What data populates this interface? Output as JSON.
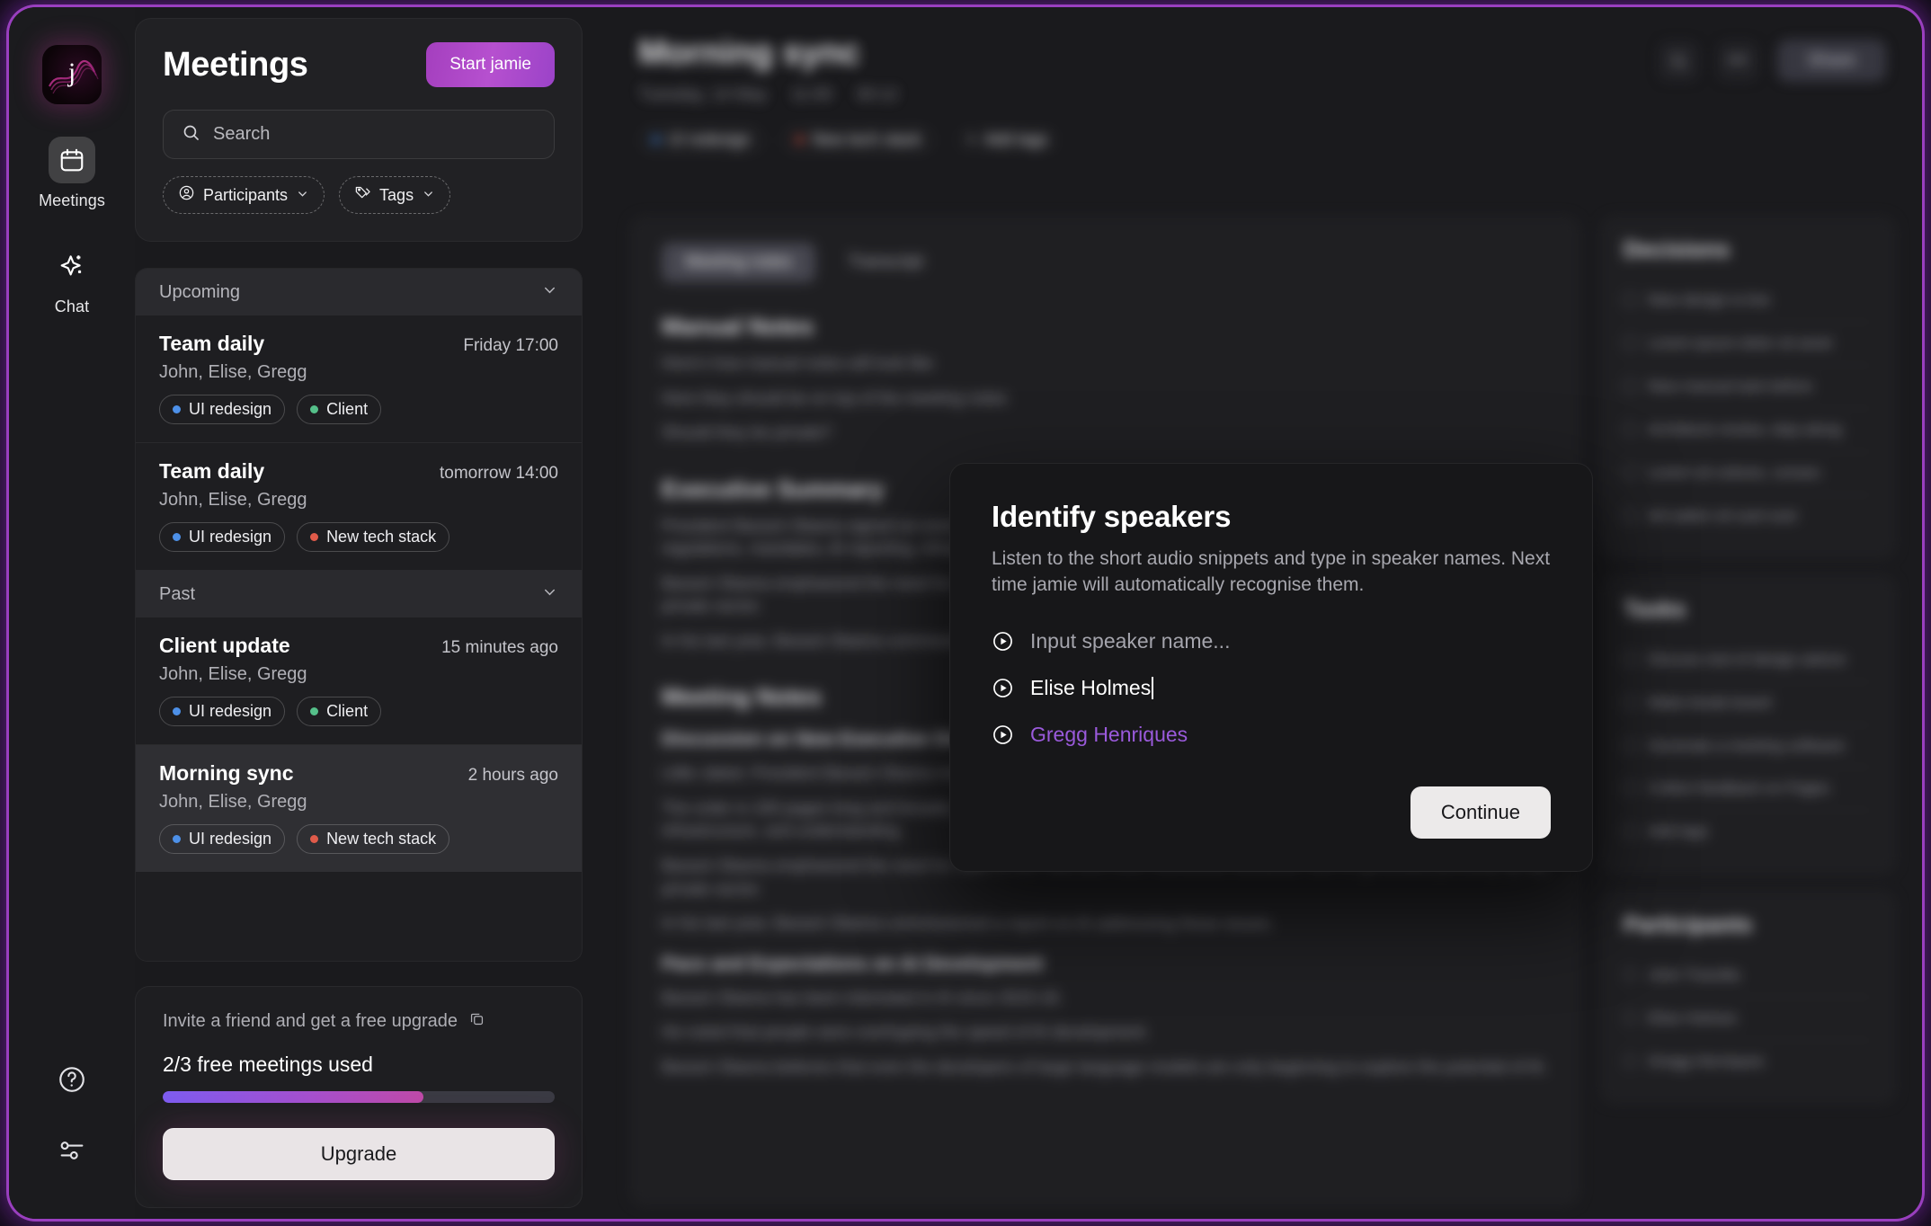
{
  "brand": {
    "logo_letter": "j"
  },
  "rail": {
    "items": [
      {
        "label": "Meetings",
        "icon": "calendar-icon",
        "active": true
      },
      {
        "label": "Chat",
        "icon": "sparkle-icon",
        "active": false
      }
    ],
    "bottom": [
      {
        "icon": "help-circle-icon"
      },
      {
        "icon": "settings-sliders-icon"
      }
    ]
  },
  "sidebar": {
    "title": "Meetings",
    "start_button": "Start jamie",
    "search": {
      "placeholder": "Search",
      "value": ""
    },
    "filters": [
      {
        "label": "Participants",
        "icon": "user-circle-icon"
      },
      {
        "label": "Tags",
        "icon": "tags-icon"
      }
    ],
    "groups": [
      {
        "label": "Upcoming",
        "meetings": [
          {
            "title": "Team daily",
            "time": "Friday 17:00",
            "people": "John, Elise, Gregg",
            "selected": false,
            "tags": [
              {
                "label": "UI redesign",
                "color": "#4d90e8"
              },
              {
                "label": "Client",
                "color": "#55c08a"
              }
            ]
          },
          {
            "title": "Team daily",
            "time": "tomorrow 14:00",
            "people": "John, Elise, Gregg",
            "selected": false,
            "tags": [
              {
                "label": "UI redesign",
                "color": "#4d90e8"
              },
              {
                "label": "New tech stack",
                "color": "#e05b4a"
              }
            ]
          }
        ]
      },
      {
        "label": "Past",
        "meetings": [
          {
            "title": "Client update",
            "time": "15 minutes ago",
            "people": "John, Elise, Gregg",
            "selected": false,
            "tags": [
              {
                "label": "UI redesign",
                "color": "#4d90e8"
              },
              {
                "label": "Client",
                "color": "#55c08a"
              }
            ]
          },
          {
            "title": "Morning sync",
            "time": "2 hours ago",
            "people": "John, Elise, Gregg",
            "selected": true,
            "tags": [
              {
                "label": "UI redesign",
                "color": "#4d90e8"
              },
              {
                "label": "New tech stack",
                "color": "#e05b4a"
              }
            ]
          }
        ]
      }
    ],
    "upgrade": {
      "invite_text": "Invite a friend and get a free upgrade",
      "copy_icon": "copy-icon",
      "usage_text": "2/3 free meetings used",
      "progress_percent": 67,
      "button": "Upgrade",
      "gradient_from": "#7d5cf0",
      "gradient_to": "#bf4aa8"
    }
  },
  "main": {
    "title": "Morning sync",
    "meta": [
      "Tuesday, 14 May",
      "11:00",
      "30:12"
    ],
    "tags": [
      {
        "label": "UI redesign",
        "color": "#4d90e8"
      },
      {
        "label": "New tech stack",
        "color": "#e05b4a"
      },
      {
        "label": "Add tags",
        "color": "#6b6b74"
      }
    ],
    "actions": {
      "search_icon": "search-icon",
      "more_icon": "more-horizontal-icon",
      "share_label": "Share"
    },
    "notes": {
      "tabs": [
        {
          "label": "Meeting notes",
          "active": true
        },
        {
          "label": "Transcript",
          "active": false
        }
      ],
      "sections": [
        {
          "heading": "Manual Notes",
          "bullets": [
            "Here's how manual notes will look like",
            "Here they should be on top of the meeting notes",
            "Should they be private?"
          ]
        },
        {
          "heading": "Executive Summary",
          "bullets": [
            "President Barack Obama signed an executive order on AI development, covering comprehensive regulation, safety regulations, mandates, AI reporting, infrastructure, and understanding.",
            "Barack Obama emphasized the need for rules of the road and more intentional interaction with AI generated primarily by the private sector.",
            "In his last year, Barack Obama commissioned a report on AI addressing these issues."
          ]
        },
        {
          "heading": "Meeting Notes",
          "subsections": [
            {
              "title": "Discussion on New Executive Order about AI",
              "bullets": [
                "Little Jaleel, President Barack Obama mentioned new executive order signed by President Biden.",
                "The order is 100 pages long and broadly covers comprehensive regulation, safety regulations, mandates, AI reporting, infrastructure, and understanding.",
                "Barack Obama emphasized the need for rules of the road and more intentional interaction with AI generated primarily by the private sector.",
                "In his last year, Barack Obama commissioned a report on AI addressing these issues."
              ]
            },
            {
              "title": "Pace and Expectations on AI Development",
              "bullets": [
                "Barack Obama has been interested in AI since 2015-16.",
                "He noted that people were overhyping the speed of AI development.",
                "Barack Obama believes that even the developers of large language models are only beginning to explore the potential of AI."
              ]
            }
          ]
        }
      ]
    },
    "right_rail": [
      {
        "title": "Decisions",
        "items": [
          "New design is live",
          "Lorem ipsum dolor sit amet",
          "New manual task before",
          "Architects review, step along",
          "Lorem sit colores, consec",
          "Ad saiten sit suet suer"
        ]
      },
      {
        "title": "Tasks",
        "items": [
          "Discuss rest of design advice",
          "Make break board",
          "Generate a meeting software",
          "Collect feedback on Pages",
          "Add tags"
        ]
      },
      {
        "title": "Participants",
        "items": [
          "John Travolta",
          "Elise Holmes",
          "Gregg Henriques"
        ]
      }
    ]
  },
  "modal": {
    "title": "Identify speakers",
    "description": "Listen to the short audio snippets and type in speaker names. Next time jamie will automatically recognise them.",
    "speakers": [
      {
        "name": "Input speaker name...",
        "state": "placeholder",
        "play_icon": "play-circle-icon"
      },
      {
        "name": "Elise Holmes",
        "state": "typed",
        "play_icon": "play-circle-icon"
      },
      {
        "name": "Gregg Henriques",
        "state": "done",
        "play_icon": "play-circle-icon"
      }
    ],
    "continue_label": "Continue",
    "accent_color": "#9a5adb"
  }
}
